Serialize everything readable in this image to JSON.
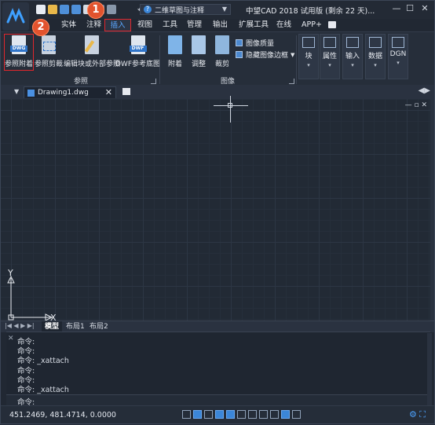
{
  "titlebar": {
    "workspace": "二维草图与注释",
    "window_title": "中望CAD 2018 试用版 (剩余 22 天)..."
  },
  "menu_tabs": [
    "实体",
    "注释",
    "插入",
    "视图",
    "工具",
    "管理",
    "输出",
    "扩展工具",
    "在线",
    "APP+"
  ],
  "active_tab": "插入",
  "ribbon": {
    "ref_group": {
      "label": "参照",
      "buttons": [
        "参照附着",
        "参照剪裁",
        "编辑块或外部参照",
        "DWF参考底图"
      ],
      "icon_tags": [
        "DWG",
        "DWF"
      ]
    },
    "image_group": {
      "label": "图像",
      "buttons": [
        "附着",
        "调整",
        "裁剪"
      ],
      "small": [
        "图像质量",
        "隐藏图像边框"
      ]
    },
    "right_buttons": [
      "块",
      "属性",
      "输入",
      "数据",
      "DGN"
    ]
  },
  "badges": [
    "1",
    "2"
  ],
  "document_tab": "Drawing1.dwg",
  "axes": {
    "x": "X",
    "y": "Y"
  },
  "layout_tabs": [
    "模型",
    "布局1",
    "布局2"
  ],
  "command_lines": [
    "命令:",
    "命令:",
    "命令: _xattach",
    "命令:",
    "命令:",
    "命令: _xattach"
  ],
  "command_prompt": "命令:",
  "status": {
    "coords": "451.2469, 481.4714, 0.0000"
  }
}
